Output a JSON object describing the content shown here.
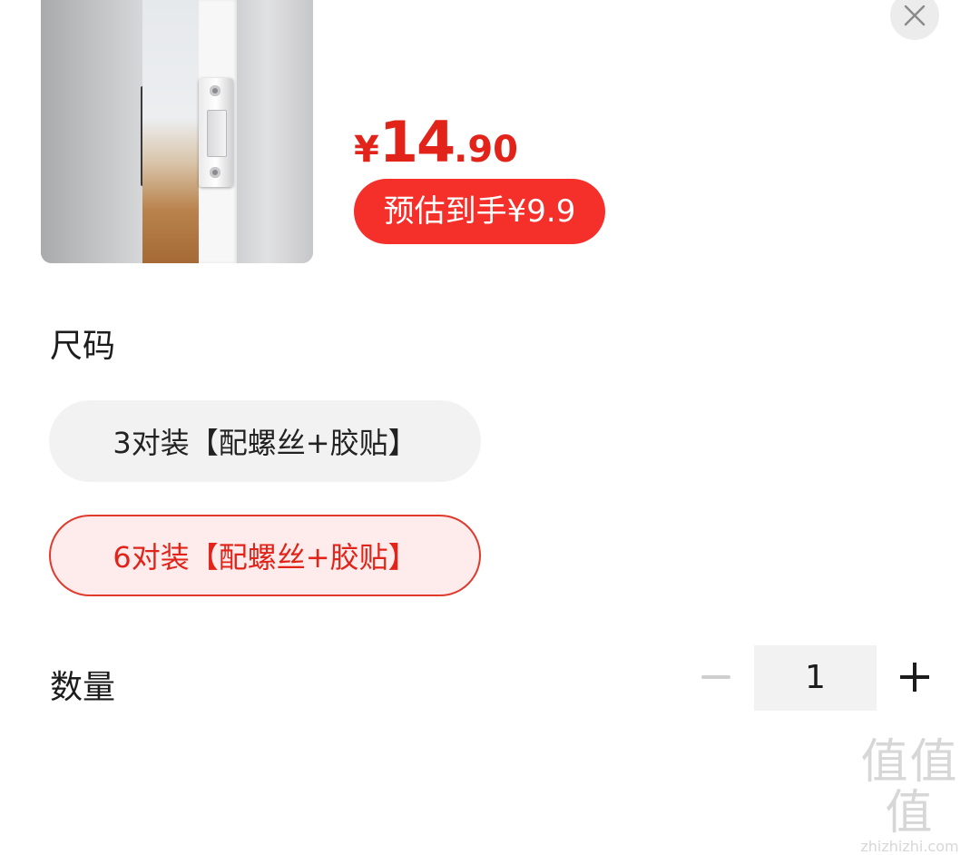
{
  "product": {
    "image_alt": "magnetic door catch product photo"
  },
  "price": {
    "symbol": "¥",
    "integer": "14",
    "decimal": ".90"
  },
  "estimate_badge": "预估到手¥9.9",
  "close_icon": "close-icon",
  "size_section": {
    "label": "尺码",
    "options": [
      {
        "label": "3对装【配螺丝+胶贴】",
        "selected": false
      },
      {
        "label": "6对装【配螺丝+胶贴】",
        "selected": true
      }
    ]
  },
  "quantity_section": {
    "label": "数量",
    "value": "1",
    "minus_icon": "minus-icon",
    "plus_icon": "plus-icon"
  },
  "watermark": {
    "logo": "值值值",
    "url": "zhizhizhi.com"
  },
  "colors": {
    "accent": "#e2231a",
    "badge": "#f5302a",
    "selected_bg": "#fdeceb",
    "option_bg": "#f2f2f2"
  }
}
